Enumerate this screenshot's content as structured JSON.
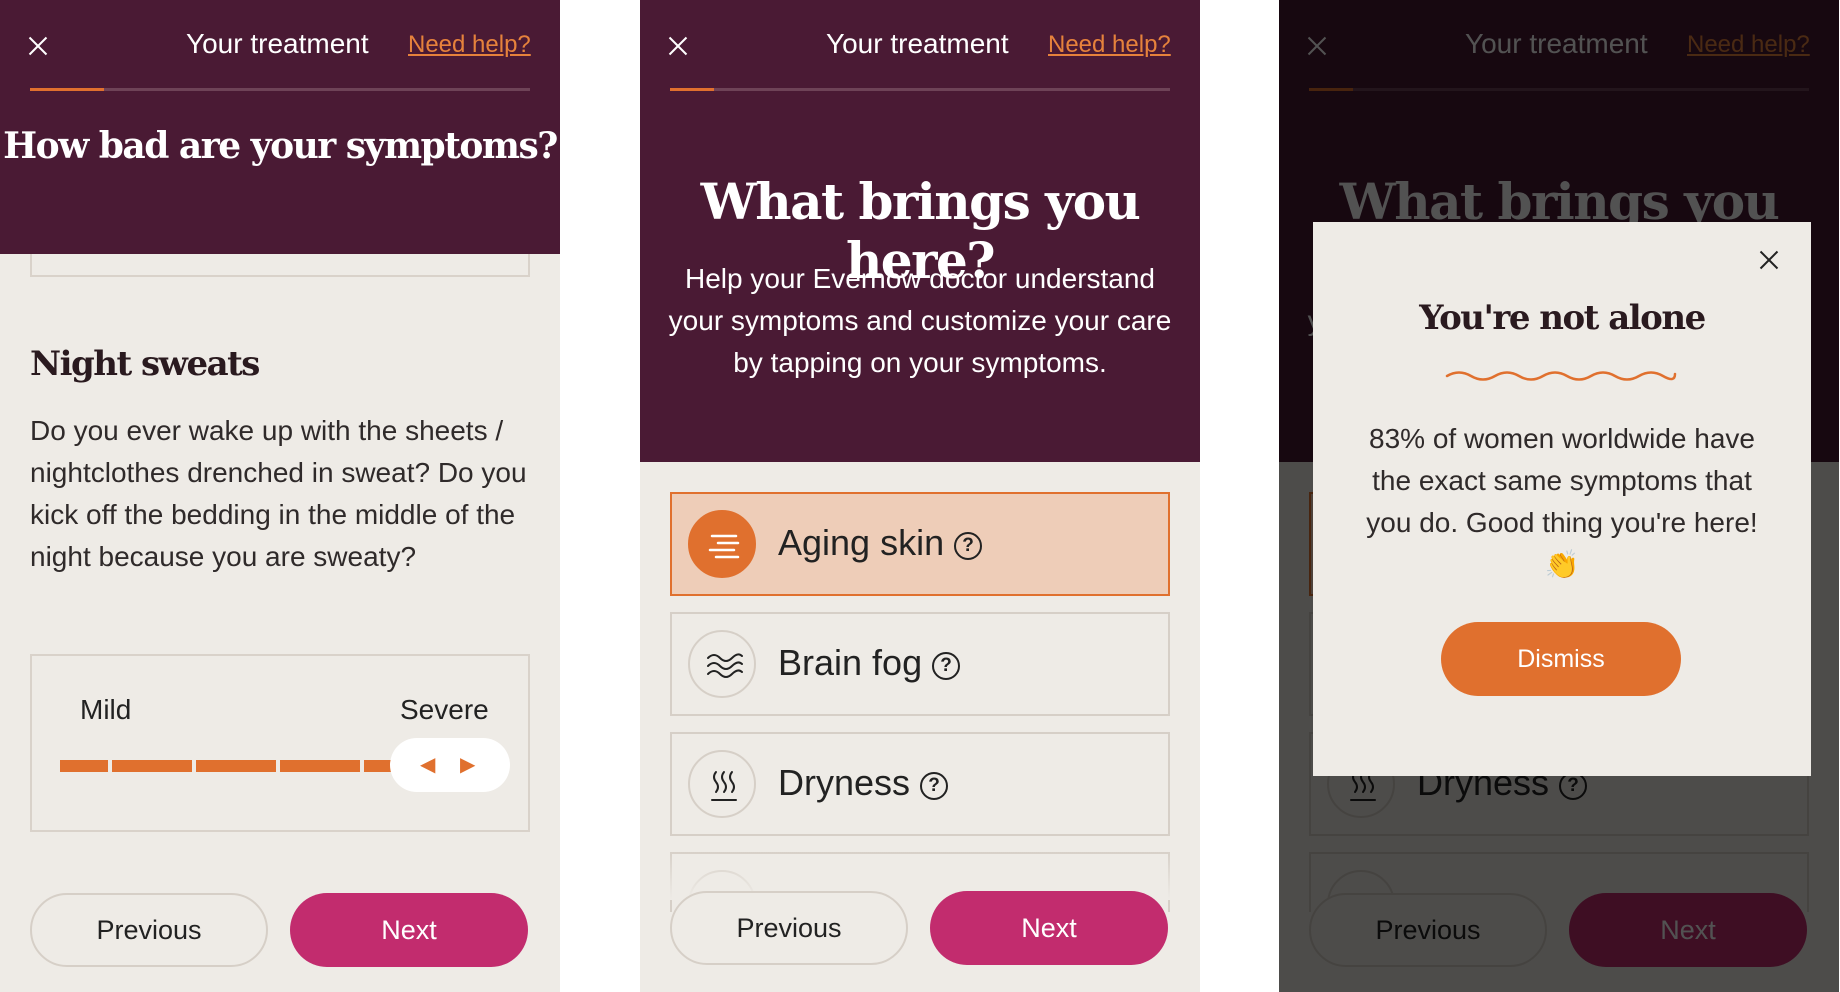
{
  "header": {
    "title": "Your treatment",
    "help_link": "Need help?"
  },
  "screen1": {
    "question": "How bad are your symptoms?",
    "symptom": {
      "title": "Night sweats",
      "description": "Do you ever wake up with the sheets / nightclothes drenched in sweat? Do you kick off the bedding in the middle of the night because you are sweaty?"
    },
    "scale": {
      "min_label": "Mild",
      "max_label": "Severe",
      "level": 1.0
    }
  },
  "screen2": {
    "title": "What brings you here?",
    "intro": "Help your Evernow doctor understand your symptoms and customize your care by tapping on your symptoms.",
    "options": [
      {
        "label": "Aging skin",
        "icon": "lines-icon",
        "selected": true
      },
      {
        "label": "Brain fog",
        "icon": "waves-icon",
        "selected": false
      },
      {
        "label": "Dryness",
        "icon": "heat-icon",
        "selected": false
      }
    ]
  },
  "modal": {
    "title": "You're not alone",
    "body": "83% of women worldwide have the exact same symptoms that you do. Good thing you're here! 👏",
    "dismiss": "Dismiss"
  },
  "footer": {
    "previous": "Previous",
    "next": "Next"
  },
  "colors": {
    "header_bg": "#4a1a34",
    "accent_orange": "#e0702e",
    "next_button": "#c22c6e",
    "page_bg": "#eeebe6"
  }
}
